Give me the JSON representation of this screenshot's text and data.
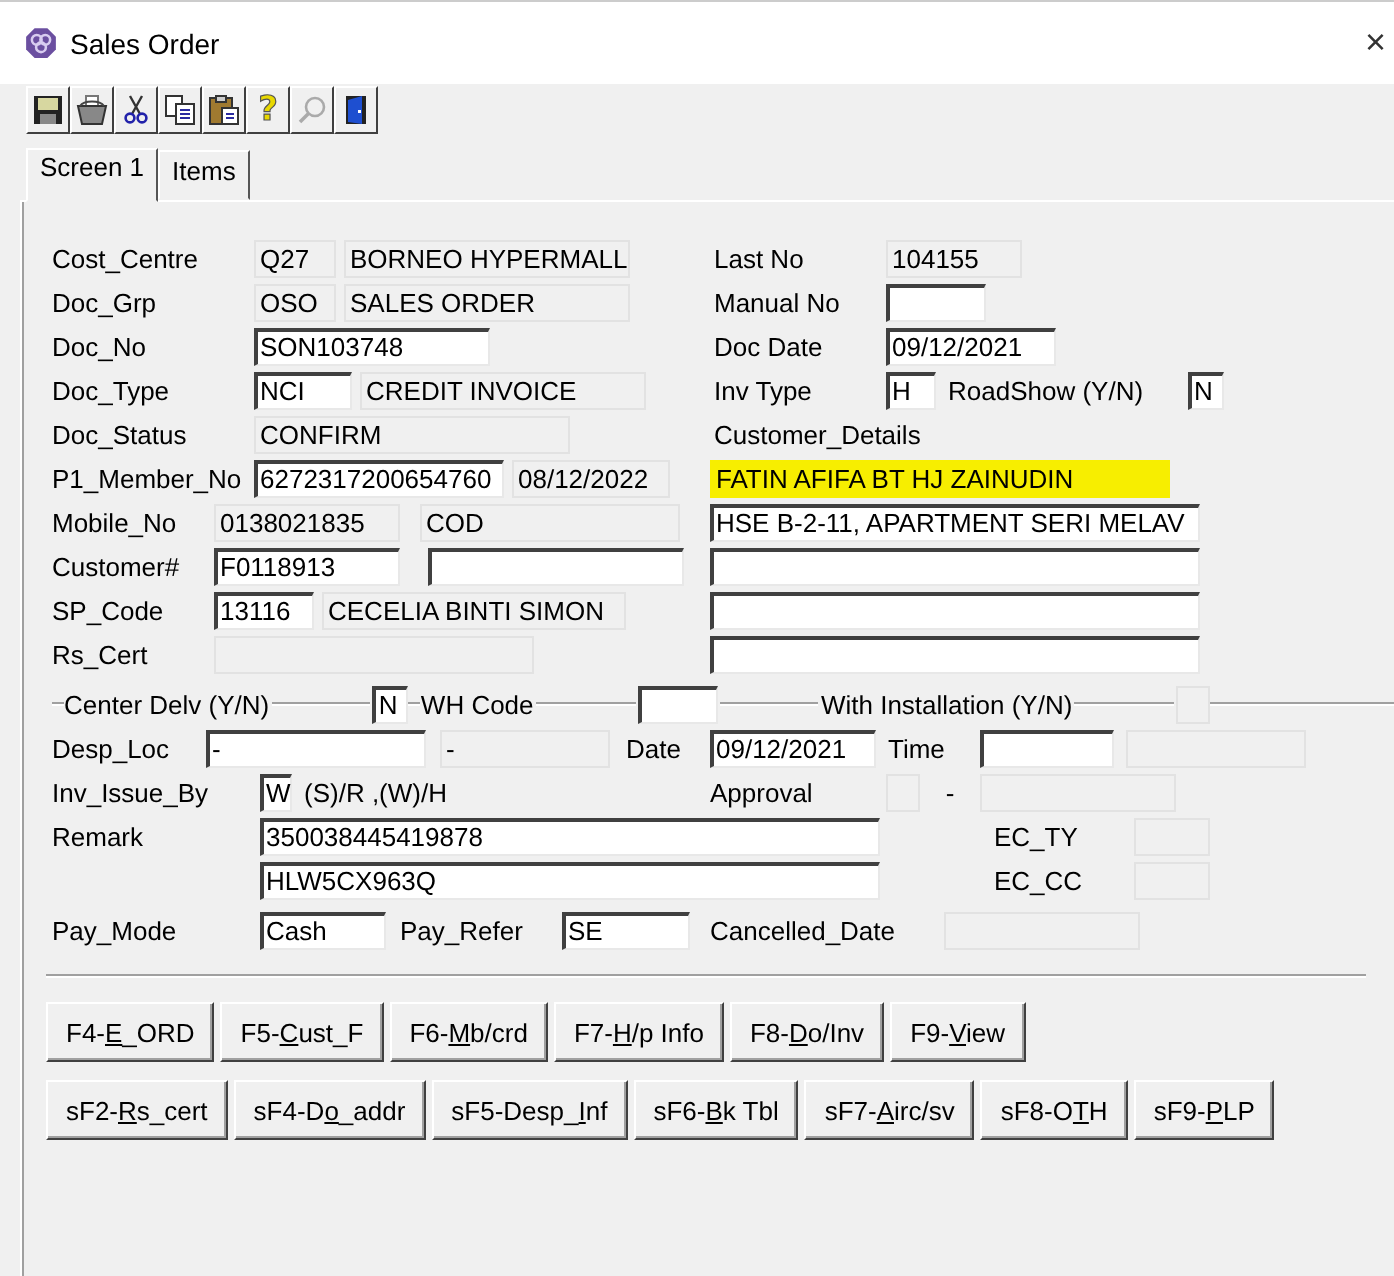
{
  "window": {
    "title": "Sales Order",
    "close": "×"
  },
  "toolbar": {
    "help": "?"
  },
  "tabs": [
    {
      "label": "Screen 1",
      "selected": true
    },
    {
      "label": "Items",
      "selected": false
    }
  ],
  "form": {
    "cost_centre": {
      "label": "Cost_Centre",
      "code": "Q27",
      "name": "BORNEO HYPERMALL"
    },
    "last_no": {
      "label": "Last No",
      "value": "104155"
    },
    "doc_grp": {
      "label": "Doc_Grp",
      "code": "OSO",
      "name": "SALES ORDER"
    },
    "manual_no": {
      "label": "Manual No"
    },
    "doc_no": {
      "label": "Doc_No",
      "value": "SON103748"
    },
    "doc_date": {
      "label": "Doc Date",
      "value": "09/12/2021"
    },
    "doc_type": {
      "label": "Doc_Type",
      "code": "NCI",
      "name": "CREDIT INVOICE"
    },
    "inv_type": {
      "label": "Inv Type",
      "value": "H"
    },
    "roadshow": {
      "label": "RoadShow (Y/N)",
      "value": "N"
    },
    "doc_status": {
      "label": "Doc_Status",
      "value": "CONFIRM"
    },
    "customer_details": {
      "label": "Customer_Details",
      "name": "FATIN AFIFA BT HJ ZAINUDIN",
      "highlighted": true,
      "address": [
        "HSE B-2-11, APARTMENT SERI MELAV"
      ]
    },
    "member_no": {
      "label": "P1_Member_No",
      "value": "6272317200654760",
      "expiry": "08/12/2022"
    },
    "mobile_no": {
      "label": "Mobile_No",
      "value": "0138021835",
      "term": "COD"
    },
    "customer": {
      "label": "Customer#",
      "value": "F0118913"
    },
    "sp_code": {
      "label": "SP_Code",
      "code": "13116",
      "name": "CECELIA BINTI SIMON"
    },
    "rs_cert": {
      "label": "Rs_Cert"
    },
    "center_delv": {
      "label": "Center Delv (Y/N)",
      "value": "N"
    },
    "wh_code": {
      "label": "WH Code"
    },
    "with_installation": {
      "label": "With Installation (Y/N)"
    },
    "desp_loc": {
      "label": "Desp_Loc",
      "value": "-",
      "name": "-"
    },
    "date": {
      "label": "Date",
      "value": "09/12/2021"
    },
    "time": {
      "label": "Time"
    },
    "inv_issue_by": {
      "label": "Inv_Issue_By",
      "value": "W",
      "hint": "(S)/R ,(W)/H"
    },
    "approval": {
      "label": "Approval",
      "separator": "-"
    },
    "remark": {
      "label": "Remark",
      "lines": [
        "350038445419878",
        "HLW5CX963Q"
      ]
    },
    "ec_ty": {
      "label": "EC_TY"
    },
    "ec_cc": {
      "label": "EC_CC"
    },
    "pay_mode": {
      "label": "Pay_Mode",
      "value": "Cash"
    },
    "pay_refer": {
      "label": "Pay_Refer",
      "value": "SE"
    },
    "cancelled_date": {
      "label": "Cancelled_Date"
    }
  },
  "buttons": [
    [
      {
        "pre": "F4-",
        "key": "E",
        "post": "_ORD"
      },
      {
        "pre": "F5-",
        "key": "C",
        "post": "ust_F"
      },
      {
        "pre": "F6-",
        "key": "M",
        "post": "b/crd"
      },
      {
        "pre": "F7-",
        "key": "H",
        "post": "/p Info"
      },
      {
        "pre": "F8-",
        "key": "D",
        "post": "o/Inv"
      },
      {
        "pre": "F9-",
        "key": "V",
        "post": "iew"
      }
    ],
    [
      {
        "pre": "sF2-",
        "key": "R",
        "post": "s_cert"
      },
      {
        "pre": "sF4-D",
        "key": "o",
        "post": "_addr"
      },
      {
        "pre": "sF5-Desp_",
        "key": "I",
        "post": "nf"
      },
      {
        "pre": "sF6-",
        "key": "B",
        "post": "k Tbl"
      },
      {
        "pre": "sF7-",
        "key": "A",
        "post": "irc/sv"
      },
      {
        "pre": "sF8-O",
        "key": "T",
        "post": "H"
      },
      {
        "pre": "sF9-",
        "key": "P",
        "post": "LP"
      }
    ]
  ]
}
